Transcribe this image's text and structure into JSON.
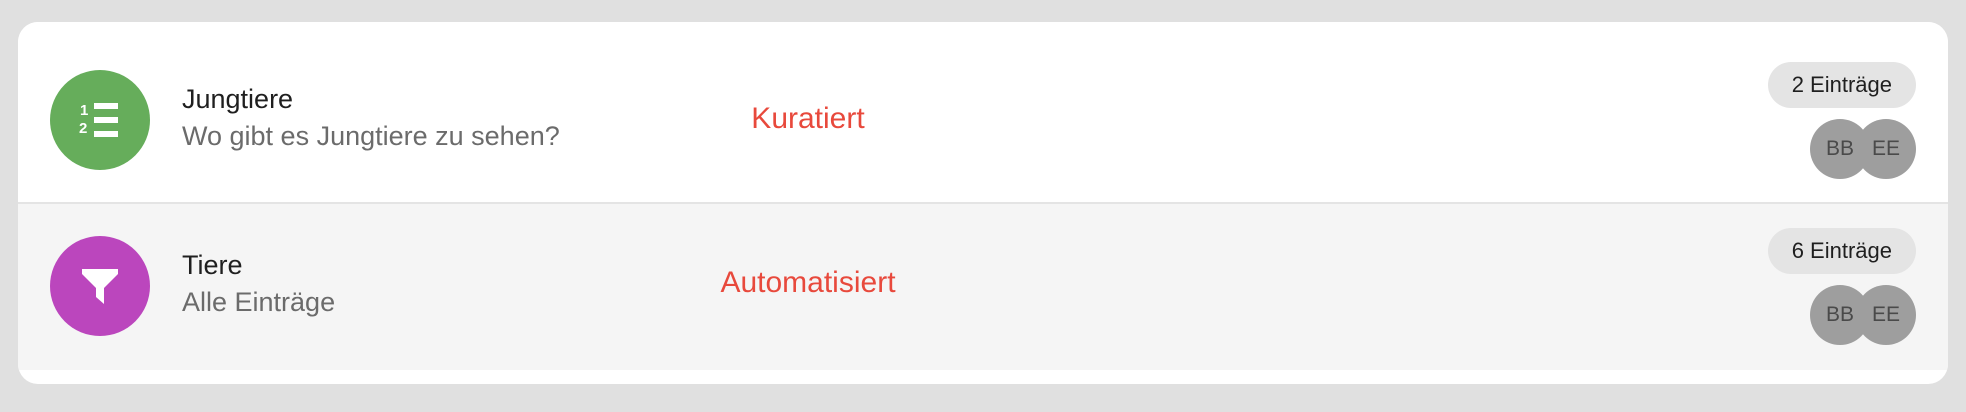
{
  "collections": [
    {
      "icon": "numbered-list-icon",
      "icon_color": "#66ad5b",
      "title": "Jungtiere",
      "subtitle": "Wo gibt es Jungtiere zu sehen?",
      "type_label": "Kuratiert",
      "entries_label": "2 Einträge",
      "users": [
        "BB",
        "EE"
      ]
    },
    {
      "icon": "filter-icon",
      "icon_color": "#bb46bd",
      "title": "Tiere",
      "subtitle": "Alle Einträge",
      "type_label": "Automatisiert",
      "entries_label": "6 Einträge",
      "users": [
        "BB",
        "EE"
      ]
    }
  ],
  "colors": {
    "label_accent": "#e8493c",
    "avatar_grey": "#9e9e9e"
  }
}
